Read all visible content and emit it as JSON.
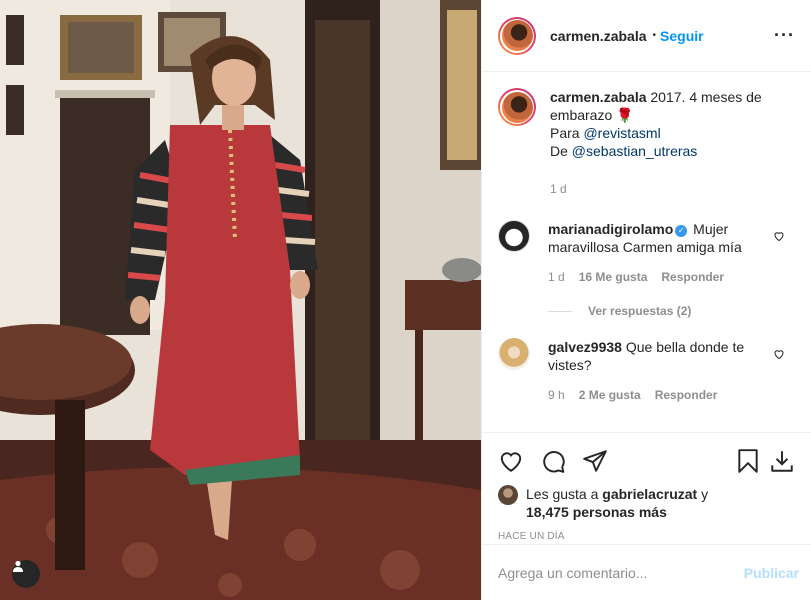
{
  "header": {
    "username": "carmen.zabala",
    "dot": "•",
    "follow_label": "Seguir",
    "more_label": "···"
  },
  "caption": {
    "username": "carmen.zabala",
    "text_line": "2017. 4 meses de embarazo",
    "emoji": "🌹",
    "para_prefix": "Para",
    "para_mention": "@revistasml",
    "de_prefix": "De",
    "de_mention": "@sebastian_utreras",
    "time": "1 d"
  },
  "comments": [
    {
      "username": "marianadigirolamo",
      "verified": true,
      "text": "Mujer maravillosa Carmen amiga mía",
      "time": "1 d",
      "likes": "16 Me gusta",
      "reply_label": "Responder",
      "view_replies": "Ver respuestas (2)"
    },
    {
      "username": "galvez9938",
      "verified": false,
      "text": "Que bella donde te vistes?",
      "time": "9 h",
      "likes": "2 Me gusta",
      "reply_label": "Responder"
    }
  ],
  "likes": {
    "prefix": "Les gusta a",
    "user": "gabrielacruzat",
    "and": "y",
    "count": "18,475 personas más"
  },
  "post_time": "HACE UN DÍA",
  "add_comment": {
    "placeholder": "Agrega un comentario...",
    "publish_label": "Publicar"
  },
  "icons": {
    "like": "heart-icon",
    "comment": "comment-icon",
    "share": "send-icon",
    "save": "bookmark-icon",
    "download": "download-icon",
    "tag": "person-tag-icon"
  },
  "colors": {
    "link_blue": "#0095f6",
    "mention_blue": "#00376b",
    "muted_gray": "#8e8e8e",
    "publish_disabled": "#b2dffc",
    "dress_red": "#b8383c"
  }
}
